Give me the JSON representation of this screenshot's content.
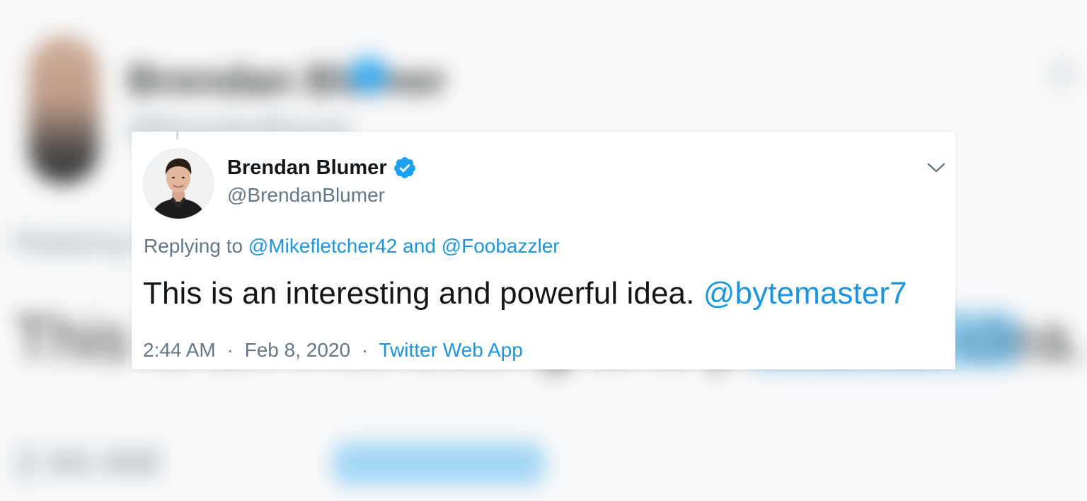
{
  "tweet": {
    "author": {
      "display_name": "Brendan Blumer",
      "handle": "@BrendanBlumer",
      "verified": true,
      "verified_icon": "verified-badge-icon"
    },
    "replying_to": {
      "prefix": "Replying to",
      "mentions": [
        "@Mikefletcher42",
        "@Foobazzler"
      ],
      "conjunction": "and"
    },
    "text": "This is an interesting and powerful idea.",
    "text_mention": "@bytemaster7",
    "time": "2:44 AM",
    "date": "Feb 8, 2020",
    "separator": "·",
    "source": "Twitter Web App",
    "menu_icon": "chevron-down-icon"
  },
  "colors": {
    "link": "#1b95e0",
    "text": "#14171a",
    "secondary": "#657786",
    "verified": "#1da1f2"
  }
}
